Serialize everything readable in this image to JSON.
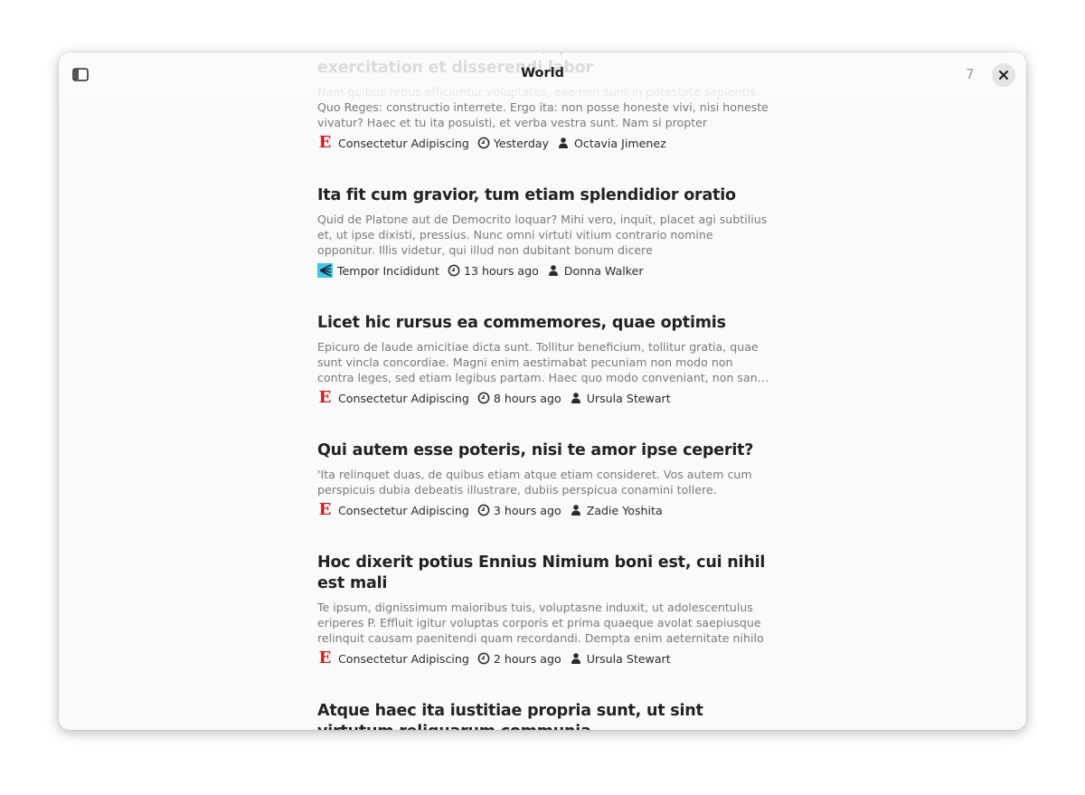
{
  "header": {
    "title": "World",
    "unread_count": "7",
    "sidebar_toggle_icon": "sidebar-show-icon",
    "close_icon": "close-icon"
  },
  "colors": {
    "accent_e": "#d71920",
    "window_bg": "#fafafa"
  },
  "articles": [
    {
      "title": "Ut enim ad minim veniam, quis nostrud exercitation et disserendi labor",
      "title_visible": "disserendi labor",
      "description": "Nam quibus rebus efficiuntur voluptates, eae non sunt in potestate sapientis. Quo Reges: constructio interrete. Ergo ita: non posse honeste vivi, nisi honeste vivatur? Haec et tu ita posuisti, et verba vestra sunt. Nam si propter voluptatem, quae est ista",
      "source": "Consectetur Adipiscing",
      "source_icon": "e-logo",
      "time": "Yesterday",
      "author": "Octavia Jimenez"
    },
    {
      "title": "Ita fit cum gravior, tum etiam splendidior oratio",
      "description": "Quid de Platone aut de Democrito loquar? Mihi vero, inquit, placet agi subtilius et, ut ipse dixisti, pressius. Nunc omni virtuti vitium contrario nomine opponitur. Illis videtur, qui illud non dubitant bonum dicere",
      "source": "Tempor Incididunt",
      "source_icon": "wave-logo",
      "time": "13 hours ago",
      "author": "Donna Walker"
    },
    {
      "title": "Licet hic rursus ea commemores, quae optimis",
      "description": "Epicuro de laude amicitiae dicta sunt. Tollitur beneficium, tollitur gratia, quae sunt vincla concordiae. Magni enim aestimabat pecuniam non modo non contra leges, sed etiam legibus partam. Haec quo modo conveniant, non sane intellego. Sin kakan malitiam dixisses",
      "source": "Consectetur Adipiscing",
      "source_icon": "e-logo",
      "time": "8 hours ago",
      "author": "Ursula Stewart"
    },
    {
      "title": "Qui autem esse poteris, nisi te amor ipse ceperit?",
      "description": "'Ita relinquet duas, de quibus etiam atque etiam consideret. Vos autem cum perspicuis dubia debeatis illustrare, dubiis perspicua conamini tollere.",
      "source": "Consectetur Adipiscing",
      "source_icon": "e-logo",
      "time": "3 hours ago",
      "author": "Zadie Yoshita"
    },
    {
      "title": "Hoc dixerit potius Ennius Nimium boni est, cui nihil est mali",
      "description": "Te ipsum, dignissimum maioribus tuis, voluptasne induxit, ut adolescentulus eriperes P. Effluit igitur voluptas corporis et prima quaeque avolat saepiusque relinquit causam paenitendi quam recordandi. Dempta enim aeternitate nihilo beatior Iuppiter quam",
      "source": "Consectetur Adipiscing",
      "source_icon": "e-logo",
      "time": "2 hours ago",
      "author": "Ursula Stewart"
    },
    {
      "title": "Atque haec ita iustitiae propria sunt, ut sint virtutum reliquarum communia",
      "description": "",
      "source": "",
      "source_icon": "",
      "time": "",
      "author": ""
    }
  ]
}
